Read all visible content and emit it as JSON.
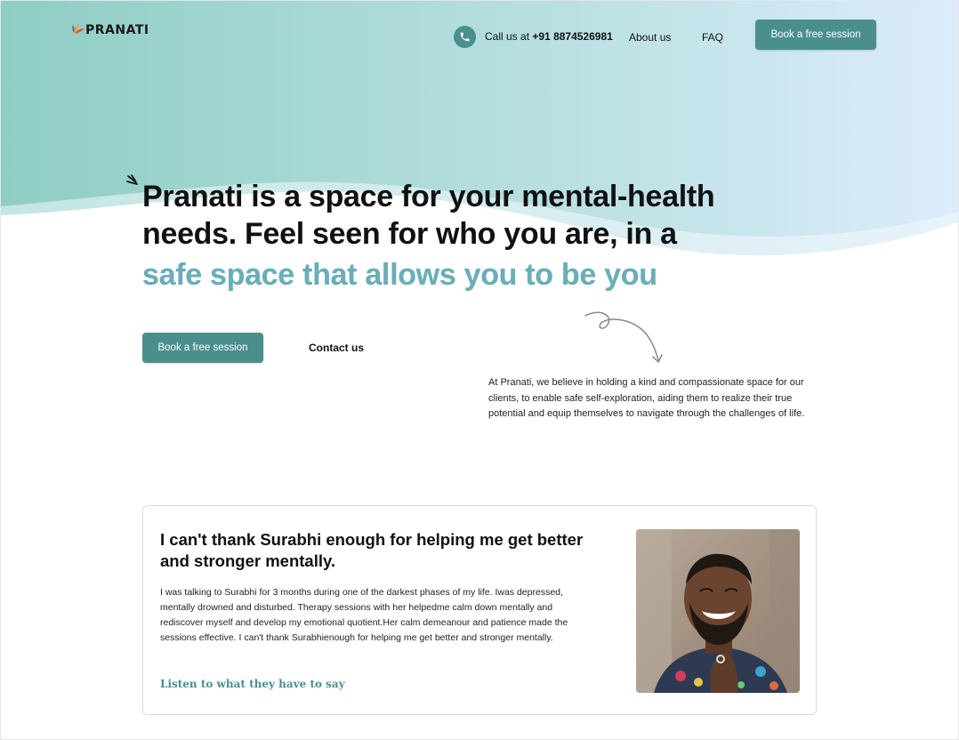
{
  "brand": {
    "name": "PRANATI"
  },
  "header": {
    "call_prefix": "Call us at",
    "phone": "+91 8874526981",
    "nav": [
      "About us",
      "FAQ"
    ],
    "cta": "Book a free session"
  },
  "hero": {
    "line1": "Pranati is a space for your mental-health",
    "line2": "needs. Feel seen for who you are, in a",
    "accent": "safe space that  allows you to be you",
    "cta_primary": "Book a free session",
    "cta_secondary": "Contact us",
    "intro": "At Pranati, we believe in holding a kind and compassionate space for our clients, to enable safe self-exploration, aiding them to realize their true potential and equip themselves to navigate through the challenges of life."
  },
  "testimonial": {
    "title": "I can't thank Surabhi enough for helping me get better and stronger mentally.",
    "body": "I was talking to Surabhi for 3 months during one of the darkest phases of my life. Iwas depressed, mentally drowned and disturbed. Therapy sessions with her helpedme calm down mentally and rediscover myself and develop my emotional quotient.Her calm demeanour and patience made the sessions effective. I can't thank Surabhienough for helping me get better and stronger mentally.",
    "link": "Listen to what they have to say"
  },
  "colors": {
    "brand_teal": "#4b8f8c",
    "accent_text": "#6aaeb8",
    "hero_gradient_start": "#8ecdc4",
    "hero_gradient_end": "#dcecfb"
  },
  "icons": [
    "pranati-flower-logo",
    "phone-icon",
    "burst-icon",
    "squiggle-arrow-icon",
    "person-photo"
  ]
}
